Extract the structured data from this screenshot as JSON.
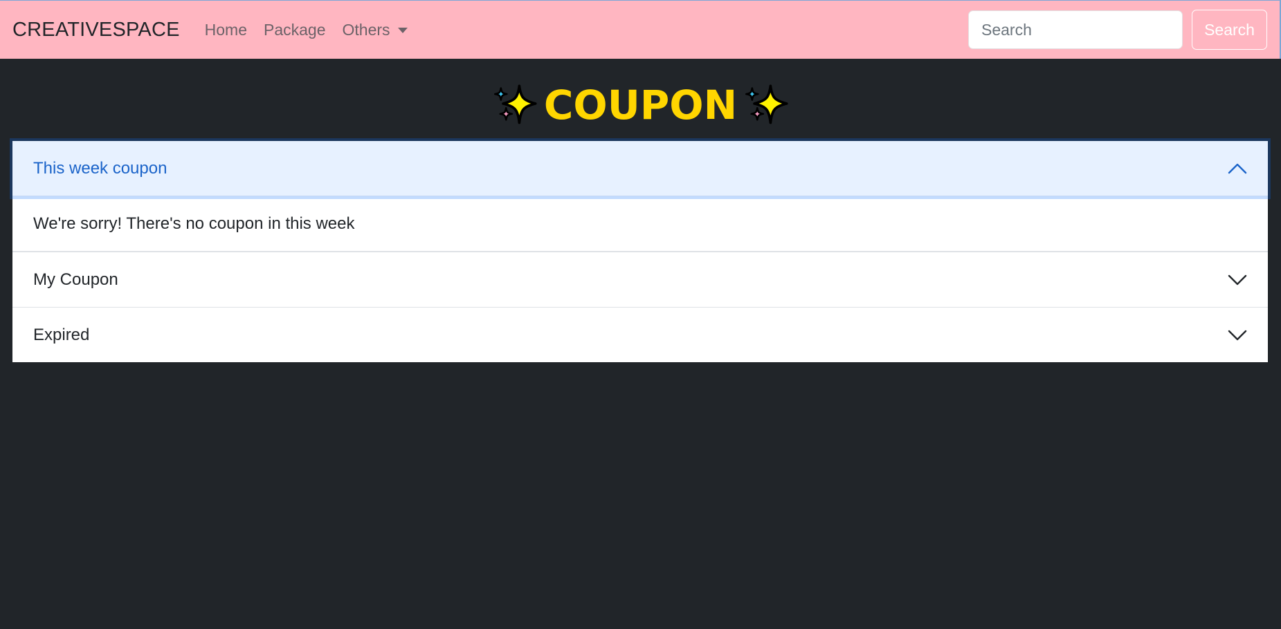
{
  "navbar": {
    "brand": "CREATIVESPACE",
    "links": [
      "Home",
      "Package",
      "Others"
    ],
    "search": {
      "placeholder": "Search",
      "value": "",
      "button_label": "Search"
    },
    "colors": {
      "background": "#ffb6c1"
    }
  },
  "page": {
    "title": "COUPON",
    "title_icons": [
      "sparkles-icon",
      "sparkles-icon"
    ],
    "title_color": "#ffd600",
    "background": "#212529"
  },
  "accordion": {
    "items": [
      {
        "header": "This week coupon",
        "expanded": true,
        "body": "We're sorry! There's no coupon in this week"
      },
      {
        "header": "My Coupon",
        "expanded": false
      },
      {
        "header": "Expired",
        "expanded": false
      }
    ],
    "active_color": "#1a63c9"
  }
}
